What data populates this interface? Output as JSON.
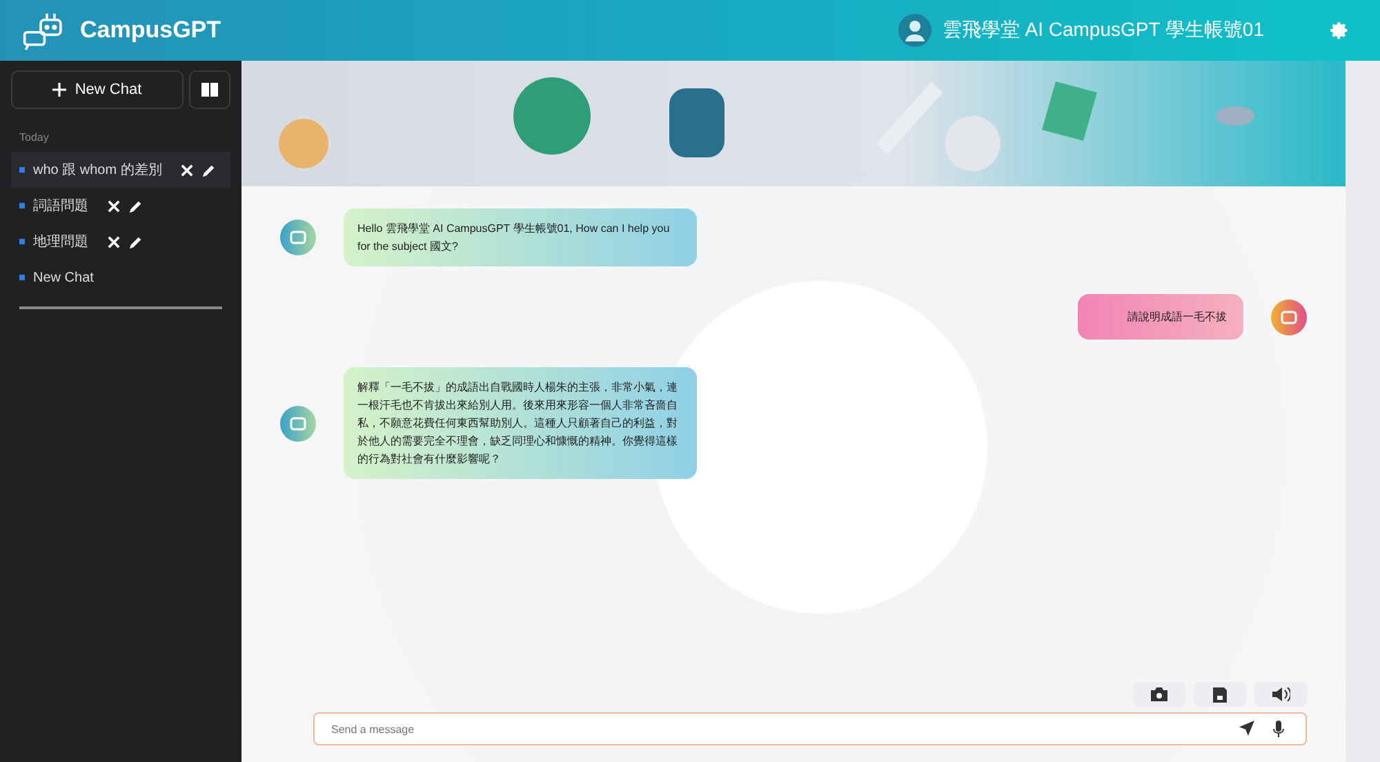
{
  "header": {
    "logo_text": "CampusGPT",
    "user_name": "雲飛學堂 AI CampusGPT 學生帳號01"
  },
  "sidebar": {
    "new_chat_label": "New Chat",
    "section_label": "Today",
    "items": [
      {
        "title": "who 跟 whom 的差別",
        "selected": true,
        "editable": true
      },
      {
        "title": "詞語問題",
        "selected": false,
        "editable": true
      },
      {
        "title": "地理問題",
        "selected": false,
        "editable": true
      },
      {
        "title": "New Chat",
        "selected": false,
        "editable": false
      }
    ]
  },
  "messages": [
    {
      "kind": "assistant",
      "text": "Hello 雲飛學堂 AI CampusGPT 學生帳號01, How can I help you for the subject 國文?"
    },
    {
      "kind": "user",
      "text": "請說明成語一毛不拔"
    },
    {
      "kind": "assistant",
      "text": "解釋「一毛不拔」的成語出自戰國時人楊朱的主張，非常小氣，連一根汗毛也不肯拔出來給別人用。後來用來形容一個人非常吝嗇自私，不願意花費任何東西幫助別人。這種人只顧著自己的利益，對於他人的需要完全不理會，缺乏同理心和慷慨的精神。你覺得這樣的行為對社會有什麼影響呢？"
    }
  ],
  "composer": {
    "placeholder": "Send a message"
  }
}
